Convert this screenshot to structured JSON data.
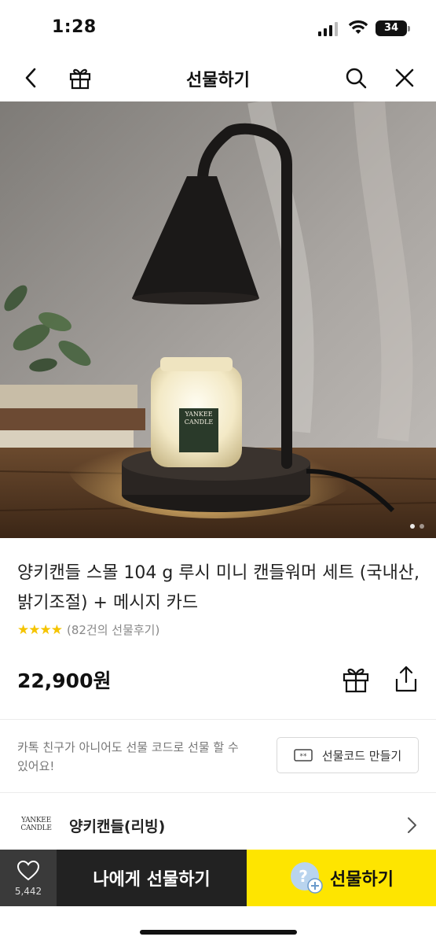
{
  "status": {
    "time": "1:28",
    "battery": "34"
  },
  "header": {
    "title": "선물하기"
  },
  "product": {
    "title": "양키캔들 스몰 104 g 루시 미니 캔들워머 세트 (국내산, 밝기조절) + 메시지 카드",
    "stars": "★★★★",
    "review_count": "(82건의 선물후기)",
    "price": "22,900원",
    "jar_label_line1": "YANKEE",
    "jar_label_line2": "CANDLE"
  },
  "giftcode": {
    "text": "카톡 친구가 아니어도 선물 코드로 선물 할 수 있어요!",
    "button_label": "선물코드 만들기"
  },
  "brand": {
    "logo_line1": "YANKEE",
    "logo_line2": "CANDLE",
    "name": "양키캔들(리빙)"
  },
  "bottom": {
    "like_count": "5,442",
    "gift_self_label": "나에게 선물하기",
    "gift_label": "선물하기"
  },
  "colors": {
    "accent": "#fee500",
    "dark": "#222222",
    "star": "#f5c400"
  }
}
